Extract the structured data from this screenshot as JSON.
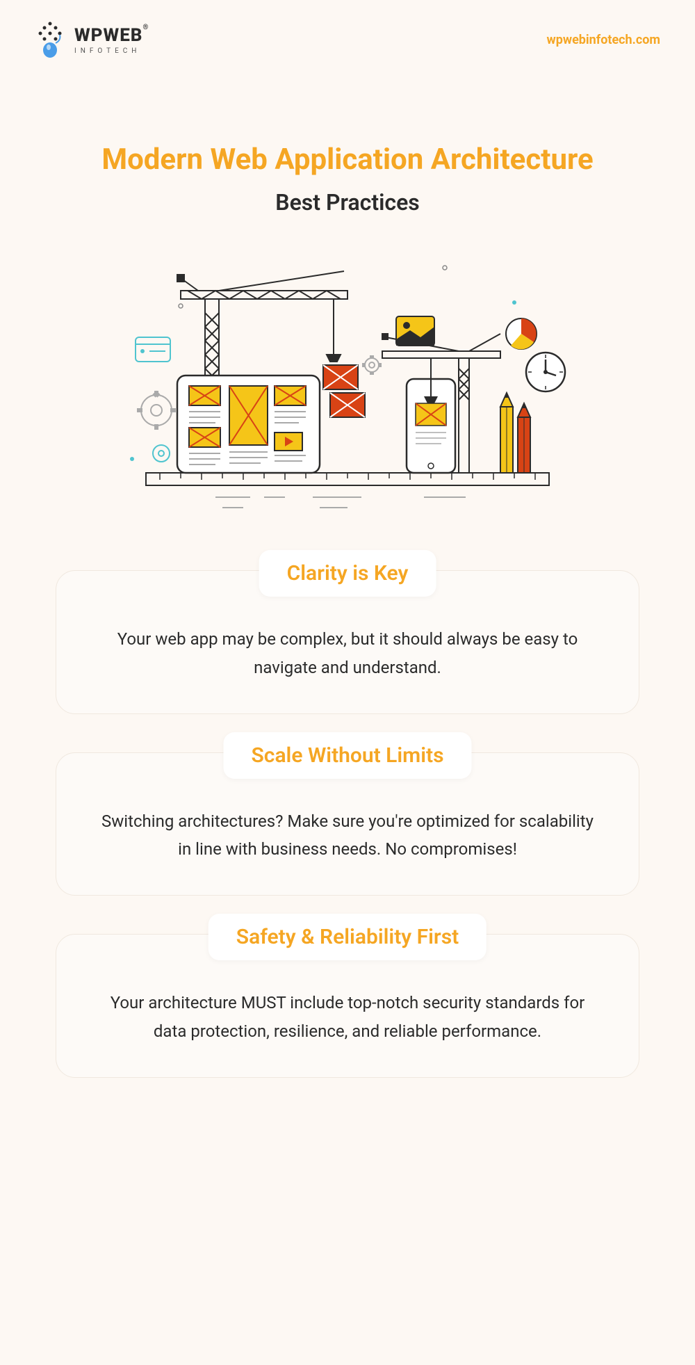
{
  "header": {
    "logo_main": "WPWEB",
    "logo_sub": "INFOTECH",
    "website": "wpwebinfotech.com"
  },
  "title": {
    "main": "Modern Web Application Architecture",
    "sub": "Best Practices"
  },
  "cards": [
    {
      "title": "Clarity is Key",
      "body": "Your web app may be complex, but it should always be easy to navigate and understand."
    },
    {
      "title": "Scale Without Limits",
      "body": "Switching architectures? Make sure you're optimized for scalability in line with business needs. No compromises!"
    },
    {
      "title": "Safety & Reliability First",
      "body": "Your architecture MUST include top-notch security standards for data protection, resilience, and reliable performance."
    }
  ]
}
